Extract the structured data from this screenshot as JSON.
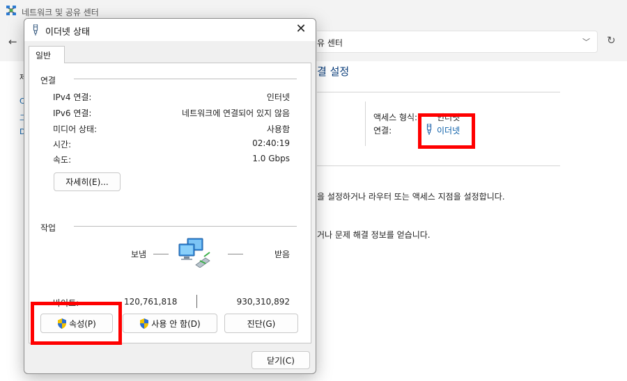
{
  "background_window": {
    "title": "네트워크 및 공유 센터",
    "address_text": "유 센터",
    "heading": "결 설정",
    "left_glyphs": [
      "제",
      "C",
      "그",
      "D"
    ],
    "access_type_label": "액세스 형식:",
    "access_type_value": "인터넷",
    "connection_label": "연결:",
    "connection_link": "이더넷",
    "desc_1": "을 설정하거나 라우터 또는 액세스 지점을 설정합니다.",
    "desc_2": "거나 문제 해결 정보를 얻습니다."
  },
  "dialog": {
    "title": "이더넷 상태",
    "tab_general": "일반",
    "connection": {
      "group_label": "연결",
      "rows": [
        {
          "label": "IPv4 연결:",
          "value": "인터넷"
        },
        {
          "label": "IPv6 연결:",
          "value": "네트워크에 연결되어 있지 않음"
        },
        {
          "label": "미디어 상태:",
          "value": "사용함"
        },
        {
          "label": "시간:",
          "value": "02:40:19"
        },
        {
          "label": "속도:",
          "value": "1.0 Gbps"
        }
      ],
      "details_button": "자세히(E)..."
    },
    "activity": {
      "group_label": "작업",
      "sent_label": "보냄",
      "received_label": "받음",
      "bytes_label": "바이트:",
      "bytes_sent": "120,761,818",
      "bytes_received": "930,310,892"
    },
    "buttons": {
      "properties": "속성(P)",
      "disable": "사용 안 함(D)",
      "diagnose": "진단(G)",
      "close": "닫기(C)"
    }
  },
  "colors": {
    "highlight": "#ff0000",
    "link": "#0a5ea8"
  },
  "icons": {
    "app": "network-center-icon",
    "ethernet": "ethernet-plug-icon",
    "activity": "network-computers-icon",
    "uac": "uac-shield-icon",
    "close": "close-icon",
    "back": "back-arrow-icon",
    "dropdown": "chevron-down-icon",
    "refresh": "refresh-icon"
  }
}
